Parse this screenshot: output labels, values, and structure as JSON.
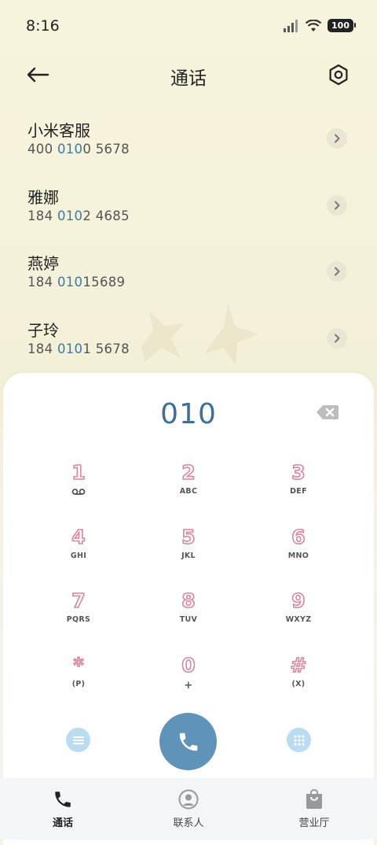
{
  "status_bar": {
    "time": "8:16",
    "battery": "100"
  },
  "header": {
    "title": "通话"
  },
  "results": [
    {
      "name": "小米客服",
      "number_pre": "400 ",
      "number_hl": "010",
      "number_post": "0 5678"
    },
    {
      "name": "雅娜",
      "number_pre": "184 ",
      "number_hl": "010",
      "number_post": "2 4685"
    },
    {
      "name": "燕婷",
      "number_pre": "184 ",
      "number_hl": "010",
      "number_post": "15689"
    },
    {
      "name": "子玲",
      "number_pre": "184 ",
      "number_hl": "010",
      "number_post": "1 5678"
    }
  ],
  "dialer": {
    "input_value": "010",
    "keys": [
      {
        "digit": "1",
        "letters": ""
      },
      {
        "digit": "2",
        "letters": "ABC"
      },
      {
        "digit": "3",
        "letters": "DEF"
      },
      {
        "digit": "4",
        "letters": "GHI"
      },
      {
        "digit": "5",
        "letters": "JKL"
      },
      {
        "digit": "6",
        "letters": "MNO"
      },
      {
        "digit": "7",
        "letters": "PQRS"
      },
      {
        "digit": "8",
        "letters": "TUV"
      },
      {
        "digit": "9",
        "letters": "WXYZ"
      },
      {
        "digit": "*",
        "letters": "(P)"
      },
      {
        "digit": "0",
        "letters": "+"
      },
      {
        "digit": "#",
        "letters": "(X)"
      }
    ]
  },
  "nav": {
    "items": [
      {
        "label": "通话",
        "icon": "phone-icon",
        "active": true
      },
      {
        "label": "联系人",
        "icon": "person-icon",
        "active": false
      },
      {
        "label": "营业厅",
        "icon": "bag-icon",
        "active": false
      }
    ]
  },
  "colors": {
    "accent": "#3e6f97",
    "call_button": "#5f93b8",
    "digit_outline": "#d9869e"
  }
}
